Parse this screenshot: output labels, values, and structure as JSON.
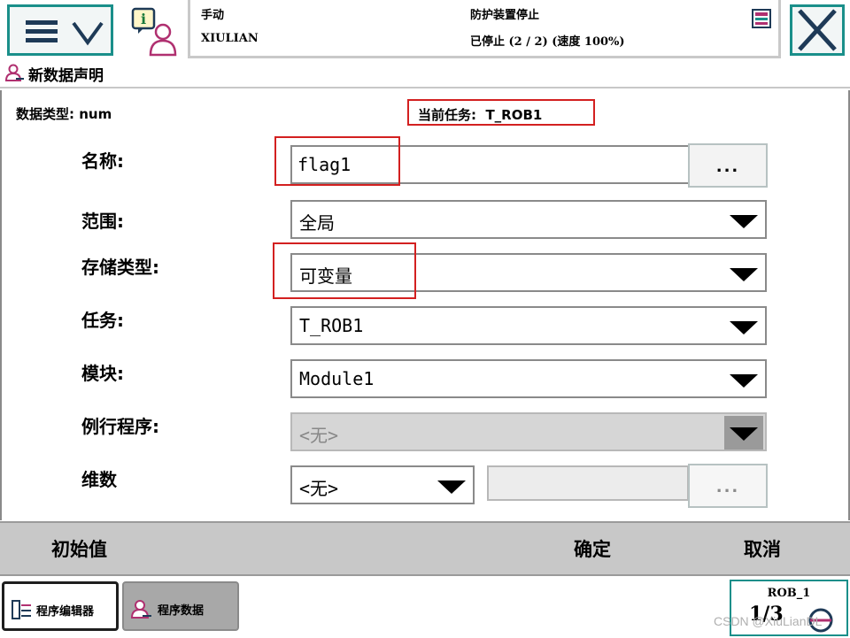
{
  "topbar": {
    "mode": "手动",
    "system_name": "XIULIAN",
    "guard_status": "防护装置停止",
    "run_status": "已停止 (2 / 2) (速度 100%)",
    "accent_color": "#1a8f8a"
  },
  "title": "新数据声明",
  "form": {
    "data_type_label": "数据类型: num",
    "current_task_label": "当前任务:  T_ROB1",
    "name_label": "名称:",
    "name_value": "flag1",
    "scope_label": "范围:",
    "scope_value": "全局",
    "storage_label": "存储类型:",
    "storage_value": "可变量",
    "task_label": "任务:",
    "task_value": "T_ROB1",
    "module_label": "模块:",
    "module_value": "Module1",
    "routine_label": "例行程序:",
    "routine_value": "<无>",
    "dimension_label": "维数",
    "dimension_value": "<无>",
    "dimension_size_value": "",
    "dots_label": "..."
  },
  "actions": {
    "initial_value": "初始值",
    "ok": "确定",
    "cancel": "取消"
  },
  "taskbar": {
    "tab_editor": "程序编辑器",
    "tab_data": "程序数据",
    "robot": "ROB_1",
    "speed": "1/3"
  },
  "watermark": "CSDN @XiuLianDL",
  "icons": [
    "menu-icon",
    "chevron-down-icon",
    "info-icon",
    "user-icon",
    "status-icon",
    "close-icon",
    "data-icon",
    "editor-icon",
    "jog-icon"
  ]
}
